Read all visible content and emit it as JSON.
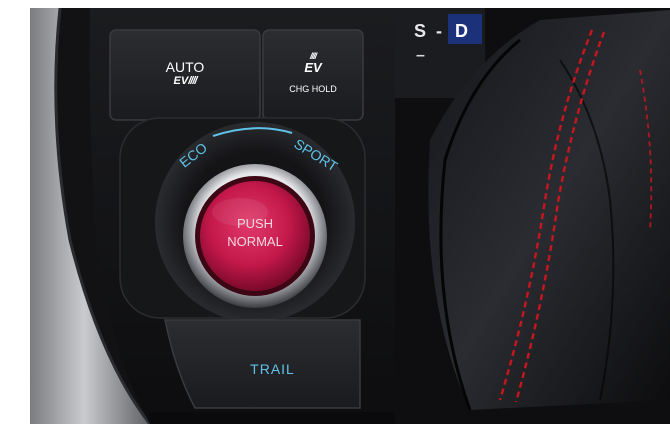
{
  "scene": {
    "colors": {
      "panel": "#141416",
      "button": "#232326",
      "accent_blue": "#5fc3e8",
      "push_button": "#c4184a",
      "stitch": "#c8161e",
      "gear_highlight": "#1d3fb8"
    }
  },
  "buttons": {
    "auto_ev": {
      "line1": "AUTO",
      "line2": "EV",
      "icon": "ev-mode-icon"
    },
    "chg_hold": {
      "label": "CHG HOLD",
      "icon": "ev-charge-hold-icon",
      "icon_text": "EV"
    },
    "drive_mode": {
      "eco": "ECO",
      "sport": "SPORT",
      "push_line1": "PUSH",
      "push_line2": "NORMAL"
    },
    "trail": {
      "label": "TRAIL"
    }
  },
  "gear_indicator": {
    "mode": "S",
    "separator": "-",
    "gear": "D",
    "minus": "–"
  }
}
